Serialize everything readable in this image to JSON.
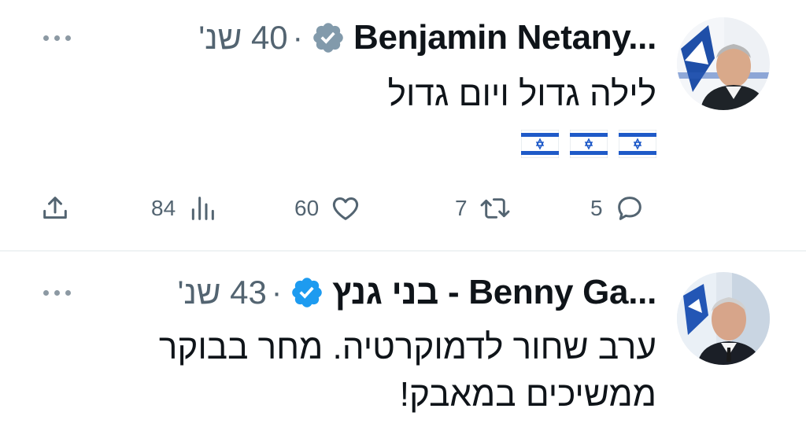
{
  "tweets": [
    {
      "author_name": "Benjamin Netany...",
      "verified": true,
      "verified_color": "#829aab",
      "time": "40 שנ'",
      "text_lines": [
        "לילה גדול ויום גדול"
      ],
      "emoji": [
        "🇮🇱",
        "🇮🇱",
        "🇮🇱"
      ],
      "actions": {
        "replies": "5",
        "retweets": "7",
        "likes": "60",
        "views": "84"
      },
      "icons": {
        "reply": "reply-icon",
        "retweet": "retweet-icon",
        "like": "heart-icon",
        "views": "views-icon",
        "share": "share-icon"
      }
    },
    {
      "author_name": "בני גנץ - Benny Ga...",
      "verified": true,
      "verified_color": "#1d9bf0",
      "time": "43 שנ'",
      "text_lines": [
        "ערב שחור לדמוקרטיה. מחר בבוקר",
        "ממשיכים במאבק!"
      ]
    }
  ],
  "colors": {
    "text_primary": "#0f1419",
    "text_secondary": "#536471",
    "divider": "#eff3f4"
  }
}
